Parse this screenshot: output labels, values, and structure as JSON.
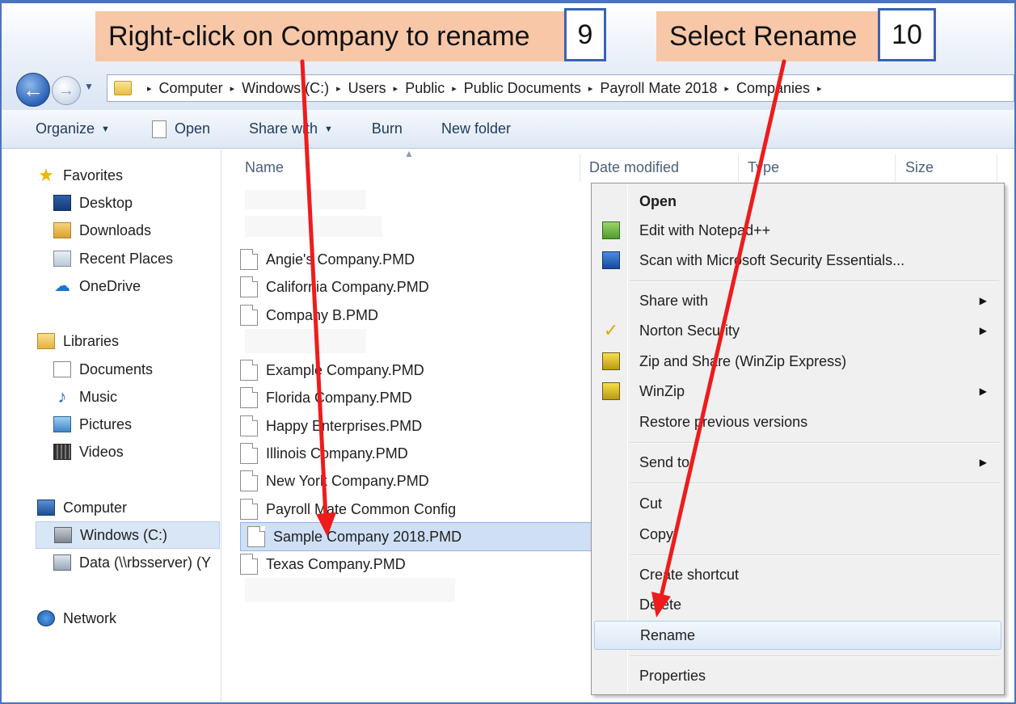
{
  "callouts": {
    "step9_text": "Right-click on Company to rename",
    "step9_number": "9",
    "step10_text": "Select Rename",
    "step10_number": "10"
  },
  "address": {
    "crumbs": [
      "Computer",
      "Windows (C:)",
      "Users",
      "Public",
      "Public Documents",
      "Payroll Mate 2018",
      "Companies"
    ],
    "separator": "▸"
  },
  "toolbar": {
    "organize": "Organize",
    "open": "Open",
    "share_with": "Share with",
    "burn": "Burn",
    "new_folder": "New folder"
  },
  "nav": {
    "favorites": "Favorites",
    "desktop": "Desktop",
    "downloads": "Downloads",
    "recent_places": "Recent Places",
    "onedrive": "OneDrive",
    "libraries": "Libraries",
    "documents": "Documents",
    "music": "Music",
    "pictures": "Pictures",
    "videos": "Videos",
    "computer": "Computer",
    "windows_c": "Windows (C:)",
    "data_drive": "Data (\\\\rbsserver) (Y",
    "network": "Network"
  },
  "columns": {
    "name": "Name",
    "date_modified": "Date modified",
    "type": "Type",
    "size": "Size"
  },
  "files": [
    "Angie's Company.PMD",
    "California Company.PMD",
    "Company B.PMD",
    "Example Company.PMD",
    "Florida Company.PMD",
    "Happy Enterprises.PMD",
    "Illinois Company.PMD",
    "New York Company.PMD",
    "Payroll Mate Common Config",
    "Sample Company 2018.PMD",
    "Texas Company.PMD"
  ],
  "context_menu": {
    "open": "Open",
    "edit_notepad": "Edit with Notepad++",
    "scan_mse": "Scan with Microsoft Security Essentials...",
    "share_with": "Share with",
    "norton": "Norton Security",
    "zip_share": "Zip and Share (WinZip Express)",
    "winzip": "WinZip",
    "restore": "Restore previous versions",
    "send_to": "Send to",
    "cut": "Cut",
    "copy": "Copy",
    "create_shortcut": "Create shortcut",
    "delete": "Delete",
    "rename": "Rename",
    "properties": "Properties",
    "submenu_glyph": "▶"
  },
  "colors": {
    "annotation_arrow": "#ee1c1c",
    "callout_bg": "#f7c7a7",
    "step_border": "#3a62b4",
    "selection": "#cfe0f6"
  },
  "icons": {
    "back": "back-arrow-icon",
    "forward": "forward-arrow-icon",
    "folder": "folder-icon",
    "file": "document-file-icon"
  }
}
